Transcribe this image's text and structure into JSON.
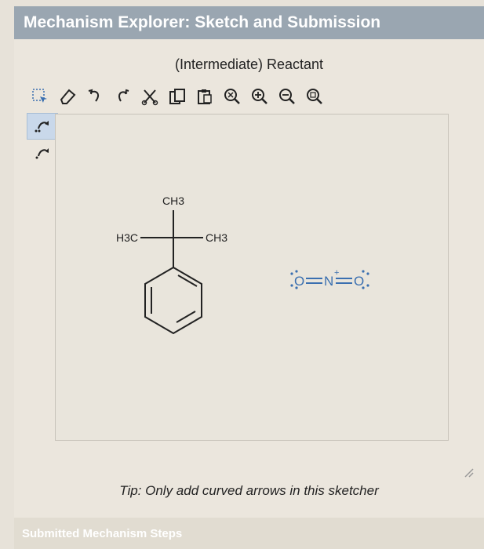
{
  "header": {
    "title": "Mechanism Explorer: Sketch and Submission"
  },
  "sketcher": {
    "subtitle": "(Intermediate) Reactant",
    "toolbar": [
      "select-icon",
      "eraser-icon",
      "undo-icon",
      "redo-icon",
      "cut-icon",
      "copy-icon",
      "paste-icon",
      "zoom-reset-icon",
      "zoom-in-icon",
      "zoom-out-icon",
      "zoom-fit-icon"
    ],
    "side_tools": [
      "curved-arrow-full-icon",
      "curved-arrow-half-icon"
    ],
    "molecule": {
      "labels": {
        "ch3_top": "CH3",
        "h3c_left": "H3C",
        "ch3_right": "CH3"
      },
      "nitronium": {
        "o_left": "O",
        "n": "N",
        "plus": "+",
        "o_right": "O"
      }
    },
    "tip": "Tip: Only add curved arrows in this sketcher"
  },
  "footer": {
    "label": "Submitted Mechanism Steps"
  },
  "colors": {
    "header_bg": "#9aa6b1",
    "accent_blue": "#3a6fb0"
  }
}
